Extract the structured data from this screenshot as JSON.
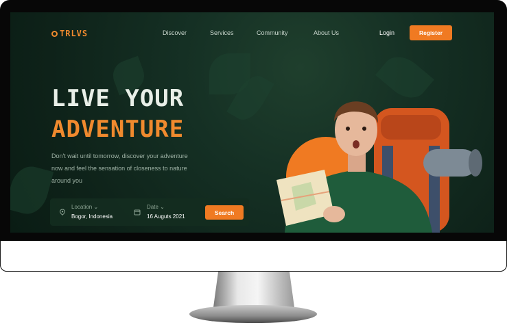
{
  "brand": {
    "name": "TRLVS"
  },
  "nav": {
    "items": [
      {
        "label": "Discover"
      },
      {
        "label": "Services"
      },
      {
        "label": "Community"
      },
      {
        "label": "About Us"
      }
    ],
    "login": "Login",
    "register": "Register"
  },
  "hero": {
    "title_line1": "LIVE YOUR",
    "title_line2": "ADVENTURE",
    "description": "Don't wait until tomorrow, discover your adventure now and feel the sensation of closeness to nature around you"
  },
  "search": {
    "location_label": "Location",
    "location_value": "Bogor, Indonesia",
    "date_label": "Date",
    "date_value": "16 Auguts 2021",
    "button": "Search"
  },
  "colors": {
    "accent": "#f07a22",
    "background": "#10261b",
    "title_light": "#e9efe8"
  }
}
